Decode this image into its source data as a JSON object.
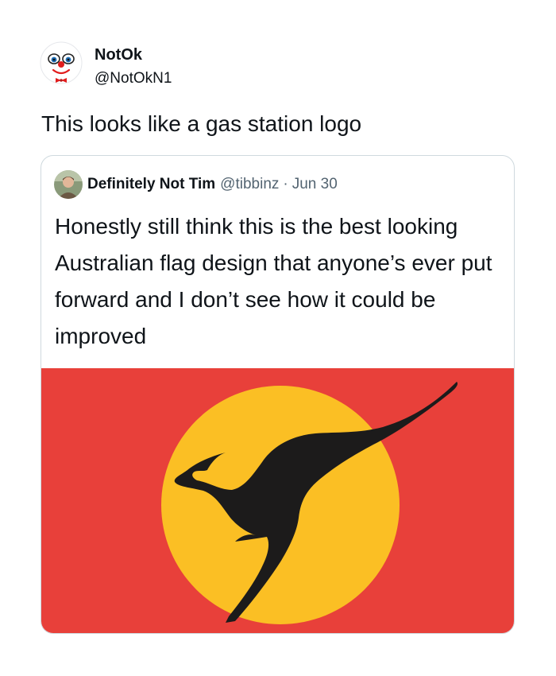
{
  "tweet": {
    "author": {
      "display_name": "NotOk",
      "handle": "@NotOkN1",
      "avatar_icon": "clown-face-icon"
    },
    "text": "This looks like a gas station logo"
  },
  "quoted_tweet": {
    "author": {
      "display_name": "Definitely Not Tim",
      "handle": "@tibbinz",
      "avatar_icon": "person-photo-icon"
    },
    "separator": "·",
    "date": "Jun 30",
    "text": "Honestly still think this is the best looking Australian flag design that anyone’s ever put forward and I don’t see how it could be improved",
    "media": {
      "type": "flag-image",
      "description_icon": "kangaroo-icon",
      "colors": {
        "background": "#e8403a",
        "sun": "#fbbf24",
        "kangaroo": "#1c1b1b"
      }
    }
  },
  "colors": {
    "text_primary": "#0f1419",
    "text_secondary": "#536471",
    "card_border": "#cfd9de"
  }
}
